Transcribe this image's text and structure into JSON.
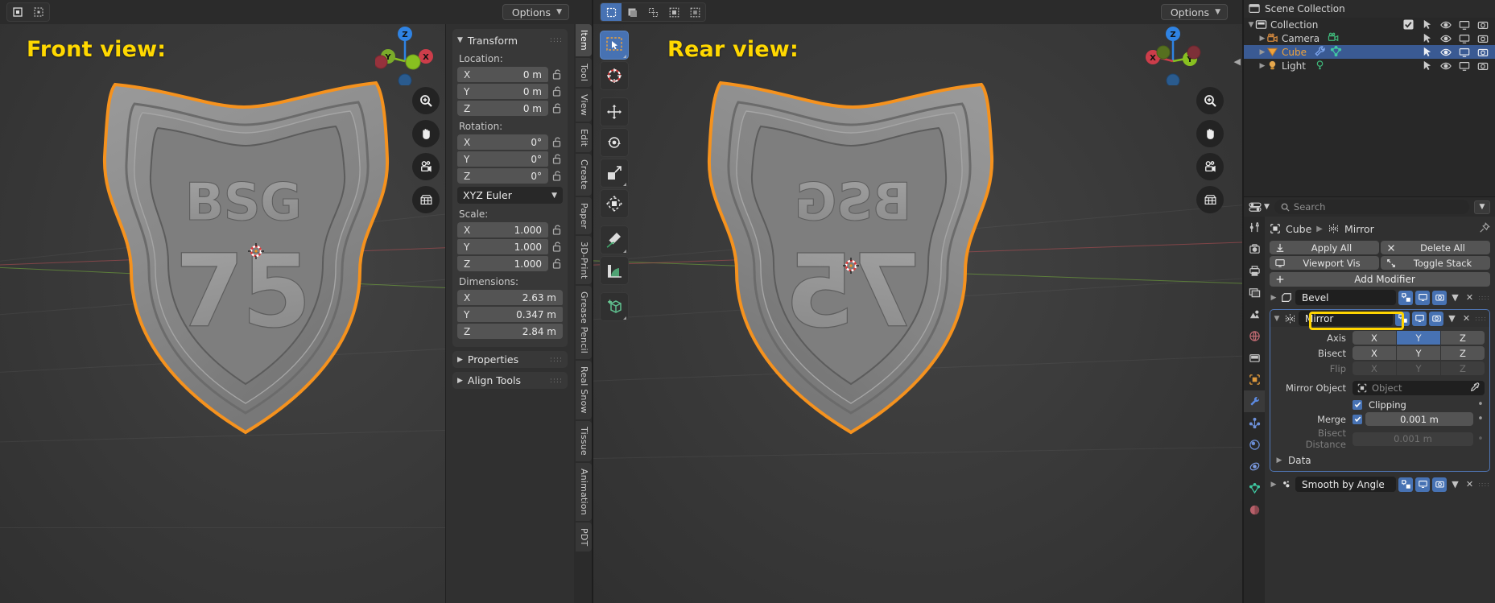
{
  "viewport_left": {
    "label": "Front view:",
    "options_label": "Options",
    "mode_icons": [
      "object-mode-icon",
      "edit-mode-icon"
    ],
    "gizmo_axes": [
      "Z",
      "Y",
      "X"
    ],
    "nav_buttons": [
      "zoom-icon",
      "pan-hand-icon",
      "camera-view-icon",
      "toggle-orthographic-icon"
    ]
  },
  "viewport_right": {
    "label": "Rear view:",
    "options_label": "Options",
    "select_modes": [
      "tweak-select-icon",
      "box-select-icon",
      "circle-select-icon",
      "lasso-select-icon",
      "select-mode-icon"
    ],
    "gizmo_axes": [
      "Z",
      "X",
      "Y"
    ],
    "tools": [
      "select-box-tool",
      "cursor-tool",
      "move-tool",
      "rotate-tool",
      "scale-tool",
      "transform-tool",
      "annotate-tool",
      "measure-tool",
      "add-cube-tool"
    ],
    "nav_buttons": [
      "zoom-icon",
      "pan-hand-icon",
      "camera-view-icon",
      "toggle-orthographic-icon"
    ]
  },
  "sidebar": {
    "tabs": [
      "Item",
      "Tool",
      "View",
      "Edit",
      "Create",
      "Paper",
      "3D-Print",
      "Grease Pencil",
      "Real Snow",
      "Tissue",
      "Animation",
      "PDT"
    ],
    "active_tab": "Item",
    "panel_title": "Transform",
    "location": {
      "label": "Location:",
      "rows": [
        {
          "axis": "X",
          "value": "0 m"
        },
        {
          "axis": "Y",
          "value": "0 m"
        },
        {
          "axis": "Z",
          "value": "0 m"
        }
      ]
    },
    "rotation": {
      "label": "Rotation:",
      "rows": [
        {
          "axis": "X",
          "value": "0°"
        },
        {
          "axis": "Y",
          "value": "0°"
        },
        {
          "axis": "Z",
          "value": "0°"
        }
      ],
      "mode": "XYZ Euler"
    },
    "scale": {
      "label": "Scale:",
      "rows": [
        {
          "axis": "X",
          "value": "1.000"
        },
        {
          "axis": "Y",
          "value": "1.000"
        },
        {
          "axis": "Z",
          "value": "1.000"
        }
      ]
    },
    "dimensions": {
      "label": "Dimensions:",
      "rows": [
        {
          "axis": "X",
          "value": "2.63 m"
        },
        {
          "axis": "Y",
          "value": "0.347 m"
        },
        {
          "axis": "Z",
          "value": "2.84 m"
        }
      ]
    },
    "collapsed_panels": [
      "Properties",
      "Align Tools"
    ]
  },
  "outliner": {
    "scene_collection": "Scene Collection",
    "rows": [
      {
        "name": "Collection",
        "icon": "collection-icon",
        "indent": 0,
        "selected": false,
        "has_checkbox": true,
        "extra_icons": [],
        "toggles": [
          "cursor-select-icon",
          "eye-icon",
          "monitor-icon",
          "camera-icon"
        ]
      },
      {
        "name": "Camera",
        "icon": "camera-object-icon",
        "indent": 1,
        "selected": false,
        "has_checkbox": false,
        "extra_icons": [
          "camera-data-icon"
        ],
        "toggles": [
          "cursor-select-icon",
          "eye-icon",
          "monitor-icon",
          "camera-icon"
        ]
      },
      {
        "name": "Cube",
        "icon": "mesh-object-icon",
        "indent": 1,
        "selected": true,
        "has_checkbox": false,
        "extra_icons": [
          "modifier-wrench-icon",
          "mesh-data-icon"
        ],
        "toggles": [
          "cursor-select-icon",
          "eye-icon",
          "monitor-icon",
          "camera-icon"
        ]
      },
      {
        "name": "Light",
        "icon": "light-object-icon",
        "indent": 1,
        "selected": false,
        "has_checkbox": false,
        "extra_icons": [
          "light-data-icon"
        ],
        "toggles": [
          "cursor-select-icon",
          "eye-icon",
          "monitor-icon",
          "camera-icon"
        ]
      }
    ]
  },
  "properties": {
    "search_placeholder": "Search",
    "breadcrumb": {
      "object": "Cube",
      "tab": "Mirror"
    },
    "tabs": [
      "tool-icon",
      "render-icon",
      "output-icon",
      "view-layer-icon",
      "scene-icon",
      "world-icon",
      "collection-props-icon",
      "object-props-icon",
      "modifier-props-icon",
      "particles-icon",
      "physics-icon",
      "constraints-icon",
      "data-props-icon",
      "material-props-icon"
    ],
    "active_tab_index": 8,
    "actions": [
      {
        "label": "Apply All",
        "icon": "apply-icon"
      },
      {
        "label": "Delete All",
        "icon": "x-icon"
      },
      {
        "label": "Viewport Vis",
        "icon": "monitor-icon"
      },
      {
        "label": "Toggle Stack",
        "icon": "expand-icon"
      }
    ],
    "add_modifier": "Add Modifier",
    "modifiers": [
      {
        "name": "Bevel",
        "icon": "bevel-icon",
        "expanded": false
      },
      {
        "name": "Mirror",
        "icon": "mirror-icon",
        "expanded": true,
        "highlighted": true
      },
      {
        "name": "Smooth by Angle",
        "icon": "smooth-by-angle-icon",
        "expanded": false
      }
    ],
    "mirror": {
      "axis_label": "Axis",
      "axis_options": [
        "X",
        "Y",
        "Z"
      ],
      "axis_active": "Y",
      "bisect_label": "Bisect",
      "bisect_options": [
        "X",
        "Y",
        "Z"
      ],
      "bisect_active": null,
      "flip_label": "Flip",
      "flip_options": [
        "X",
        "Y",
        "Z"
      ],
      "flip_active": null,
      "mirror_object_label": "Mirror Object",
      "mirror_object_value": "Object",
      "clipping_label": "Clipping",
      "clipping_checked": true,
      "merge_label": "Merge",
      "merge_checked": true,
      "merge_value": "0.001 m",
      "bisect_distance_label": "Bisect Distance",
      "bisect_distance_value": "0.001 m",
      "data_label": "Data"
    }
  },
  "colors": {
    "accent_blue": "#4772b3",
    "highlight_yellow": "#ffd400",
    "label_yellow": "#ffd800",
    "selected_outline": "#f5921e",
    "axis_x": "#cc3d4a",
    "axis_y": "#88c020",
    "axis_z": "#2f83e3",
    "panel_bg": "#303030",
    "editor_bg": "#282828"
  }
}
